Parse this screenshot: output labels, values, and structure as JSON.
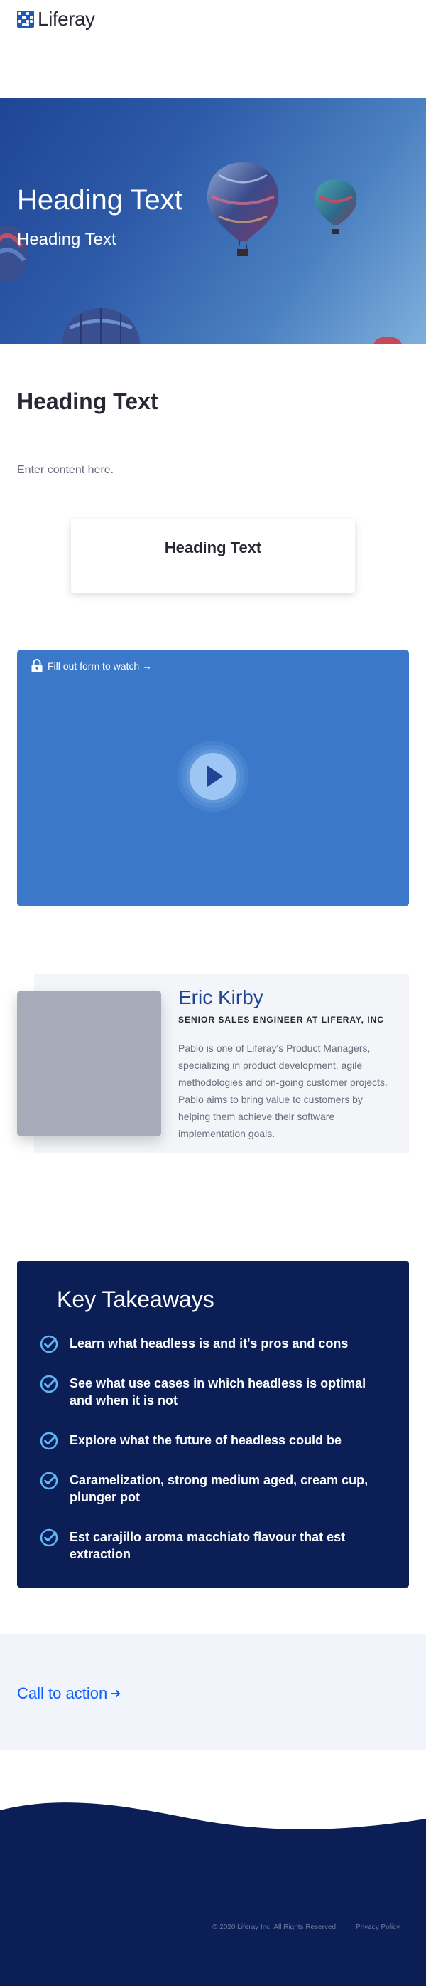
{
  "header": {
    "brand_name": "Liferay"
  },
  "hero": {
    "heading": "Heading Text",
    "subheading": "Heading Text"
  },
  "section": {
    "heading": "Heading Text",
    "content": "Enter content here."
  },
  "card": {
    "heading": "Heading Text"
  },
  "video": {
    "gate_label": "Fill out form to watch →",
    "lock_icon": "lock-icon",
    "play_icon": "play-icon"
  },
  "speaker": {
    "name": "Eric Kirby",
    "title": "SENIOR SALES ENGINEER AT LIFERAY, INC",
    "bio": "Pablo is one of Liferay's Product Managers, specializing in product development, agile methodologies and on-going customer projects. Pablo aims to bring value to customers by helping them achieve their software implementation goals."
  },
  "takeaways": {
    "heading": "Key Takeaways",
    "check_icon": "check-circle-icon",
    "items": [
      "Learn what headless is and it's pros and cons",
      "See what use cases in which headless is optimal and when it is not",
      "Explore what the future of headless could be",
      "Caramelization, strong medium aged, cream cup, plunger pot",
      "Est carajillo aroma macchiato flavour that est extraction"
    ]
  },
  "cta": {
    "label": "Call to action",
    "arrow_icon": "arrow-right-icon"
  },
  "footer": {
    "copyright": "© 2020 Liferay Inc. All Rights Reserved",
    "privacy": "Privacy Policy"
  },
  "colors": {
    "brand": "#1e5bb5",
    "hero_start": "#1f4596",
    "hero_end": "#7fb0dc",
    "video_bg": "#3b78c9",
    "takeaways_bg": "#0b1f56",
    "check": "#5fb6f5",
    "cta_bg": "#f1f4fa",
    "link": "#0b5fff",
    "footer_bg": "#0b1f56"
  }
}
